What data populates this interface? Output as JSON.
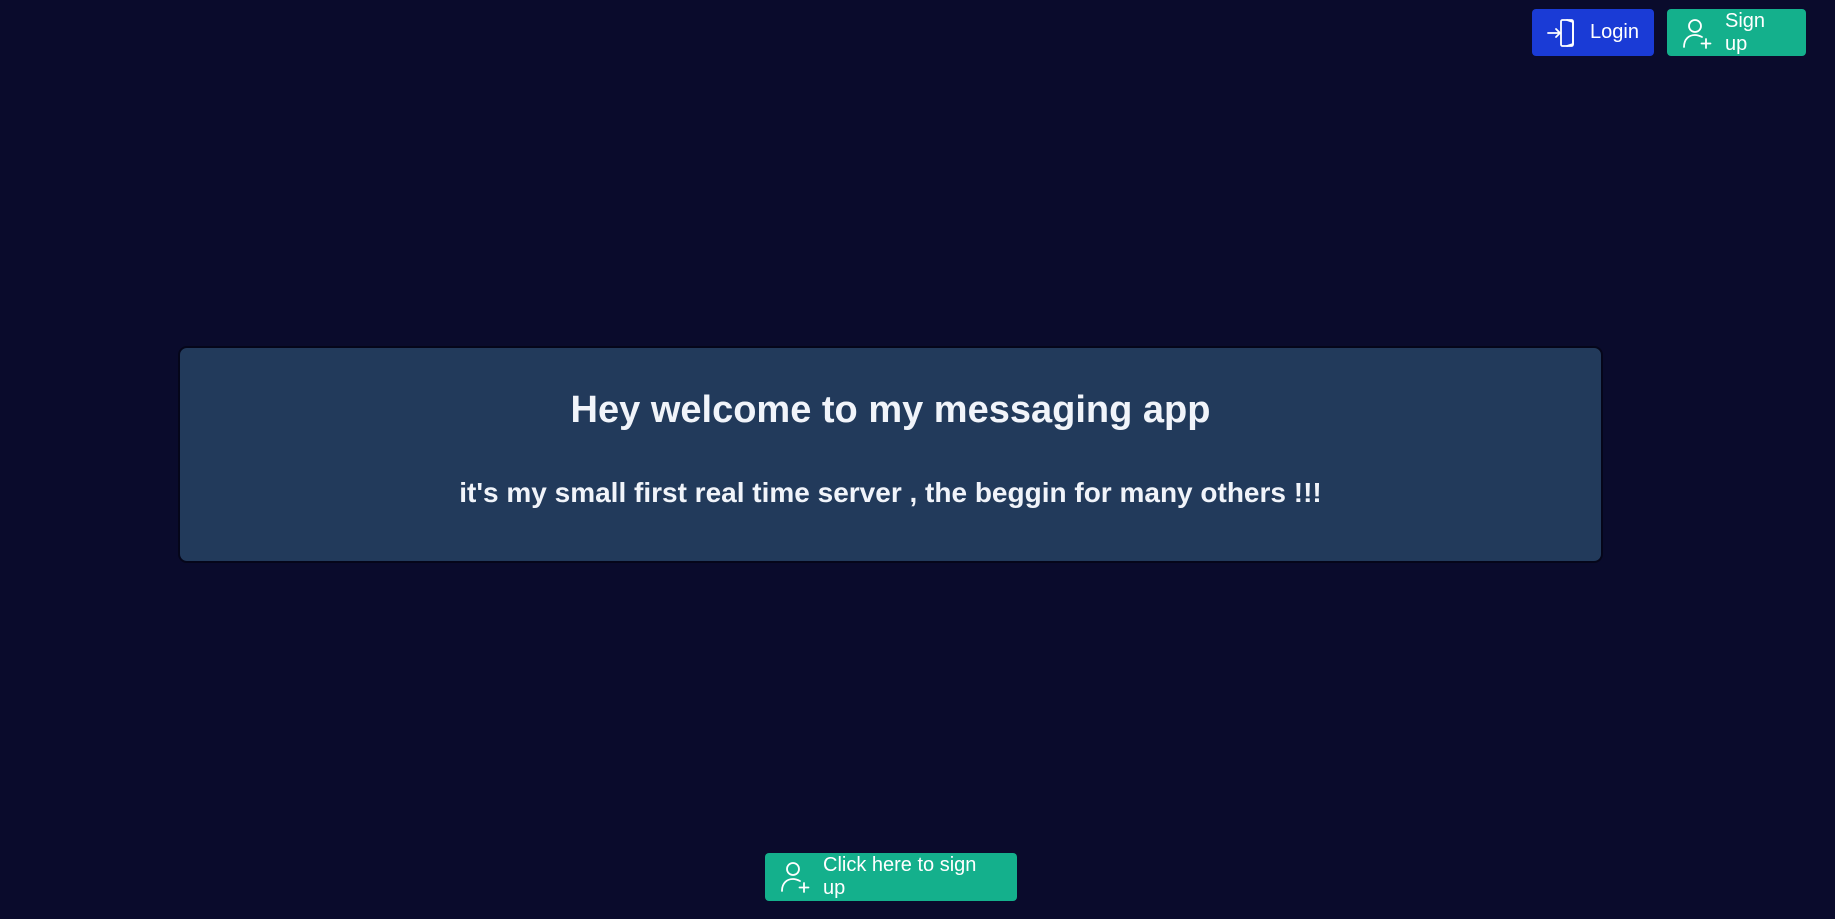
{
  "header": {
    "login_label": "Login",
    "signup_label": "Sign up",
    "login_icon": "login-door-icon",
    "signup_icon": "user-plus-icon"
  },
  "hero": {
    "title": "Hey welcome to my messaging app",
    "subtitle": "it's my small first real time server , the beggin for many others !!!"
  },
  "cta": {
    "label": "Click here to sign up",
    "icon": "user-plus-icon"
  },
  "colors": {
    "background": "#0a0b2c",
    "card": "#223a5b",
    "login_button": "#1a3bd6",
    "signup_button": "#14b08c",
    "text": "#f1f4fa"
  }
}
